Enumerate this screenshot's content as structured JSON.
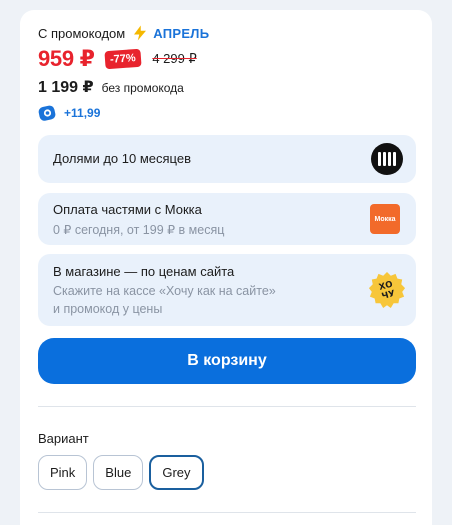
{
  "price": {
    "promo_label": "С промокодом",
    "promo_code": "АПРЕЛЬ",
    "price_with_promo": "959 ₽",
    "discount": "-77%",
    "old_price": "4 299 ₽",
    "price_without_promo": "1 199 ₽",
    "without_promo_label": "без промокода",
    "bonus": "+11,99"
  },
  "payment_options": {
    "dolyami": {
      "title": "Долями до 10 месяцев"
    },
    "mokka": {
      "title": "Оплата частями с Мокка",
      "subtitle": "0 ₽ сегодня, от 199 ₽ в месяц",
      "logo_text": "Мокка"
    },
    "store": {
      "title": "В магазине — по ценам сайта",
      "subtitle_line1": "Скажите на кассе «Хочу как на сайте»",
      "subtitle_line2": "и промокод у цены",
      "logo_text_top": "ХО",
      "logo_text_bottom": "ЧУ"
    }
  },
  "cart_button": {
    "label": "В корзину"
  },
  "variant": {
    "label": "Вариант",
    "options": [
      "Pink",
      "Blue",
      "Grey"
    ],
    "selected": "Grey"
  },
  "colors": {
    "accent_blue": "#0a6fdd",
    "price_red": "#e8232d",
    "box_bg": "#e9f1fb"
  }
}
